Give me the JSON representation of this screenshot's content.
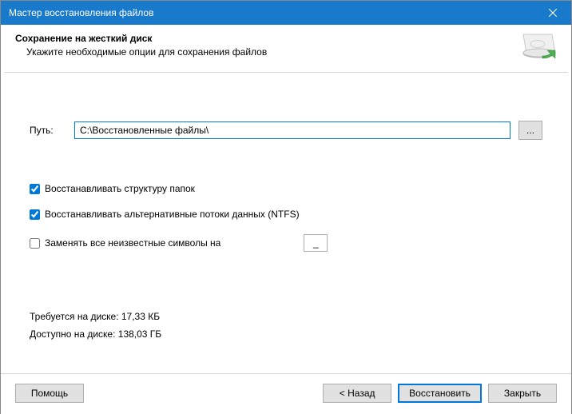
{
  "titlebar": {
    "title": "Мастер восстановления файлов"
  },
  "header": {
    "title": "Сохранение на жесткий диск",
    "subtitle": "Укажите необходимые опции для сохранения файлов"
  },
  "path": {
    "label": "Путь:",
    "value": "C:\\Восстановленные файлы\\",
    "browse_label": "..."
  },
  "options": {
    "restore_structure": "Восстанавливать структуру папок",
    "restore_ntfs": "Восстанавливать альтернативные потоки данных (NTFS)",
    "replace_unknown": "Заменять все неизвестные символы на",
    "replace_char": "_"
  },
  "disk": {
    "required": "Требуется на диске: 17,33 КБ",
    "available": "Доступно на диске: 138,03 ГБ"
  },
  "footer": {
    "help": "Помощь",
    "back": "< Назад",
    "recover": "Восстановить",
    "close": "Закрыть"
  }
}
